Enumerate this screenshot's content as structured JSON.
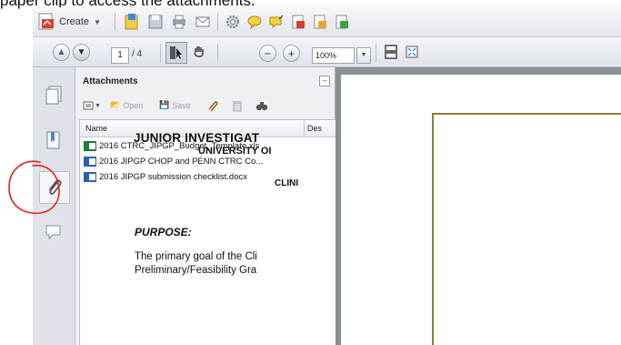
{
  "caption": "paper clip to access the attachments.",
  "toolbar": {
    "create_label": "Create",
    "create_icon": "create-pdf-icon",
    "tools": [
      "create-pdf-from-files-icon",
      "save-icon",
      "print-icon",
      "email-icon",
      "gear-icon",
      "comment-icon",
      "sticky-note-icon",
      "export-icon",
      "combine-icon",
      "sign-icon"
    ]
  },
  "nav": {
    "page_current": "1",
    "page_total": "/ 4",
    "zoom": "100%"
  },
  "sidebar": {
    "icons": [
      "pages-icon",
      "bookmarks-icon",
      "paperclip-icon",
      "comments-icon"
    ],
    "active": "paperclip-icon"
  },
  "attachments": {
    "title": "Attachments",
    "close_glyph": "–",
    "tools": {
      "open_label": "Open",
      "save_label": "Save"
    },
    "columns": {
      "name": "Name",
      "description": "Des"
    },
    "files": [
      {
        "name": "2016 CTRC_JIPGP_Budget_Template.xls",
        "type": "excel"
      },
      {
        "name": "2016 JIPGP CHOP and PENN CTRC Co...",
        "type": "word"
      },
      {
        "name": "2016 JIPGP submission checklist.docx",
        "type": "word"
      }
    ]
  },
  "document": {
    "heading1": "JUNIOR INVESTIGAT",
    "heading2": "UNIVERSITY OI",
    "heading3": "CLINI",
    "purpose": "PURPOSE:",
    "line1": "The primary goal of the Cli",
    "line2": "Preliminary/Feasibility Gra"
  },
  "colors": {
    "annotation_red": "#e0241b",
    "frame_gold": "#8a7d3c",
    "excel_green": "#1f7a3a",
    "word_blue": "#2b5fb4"
  }
}
